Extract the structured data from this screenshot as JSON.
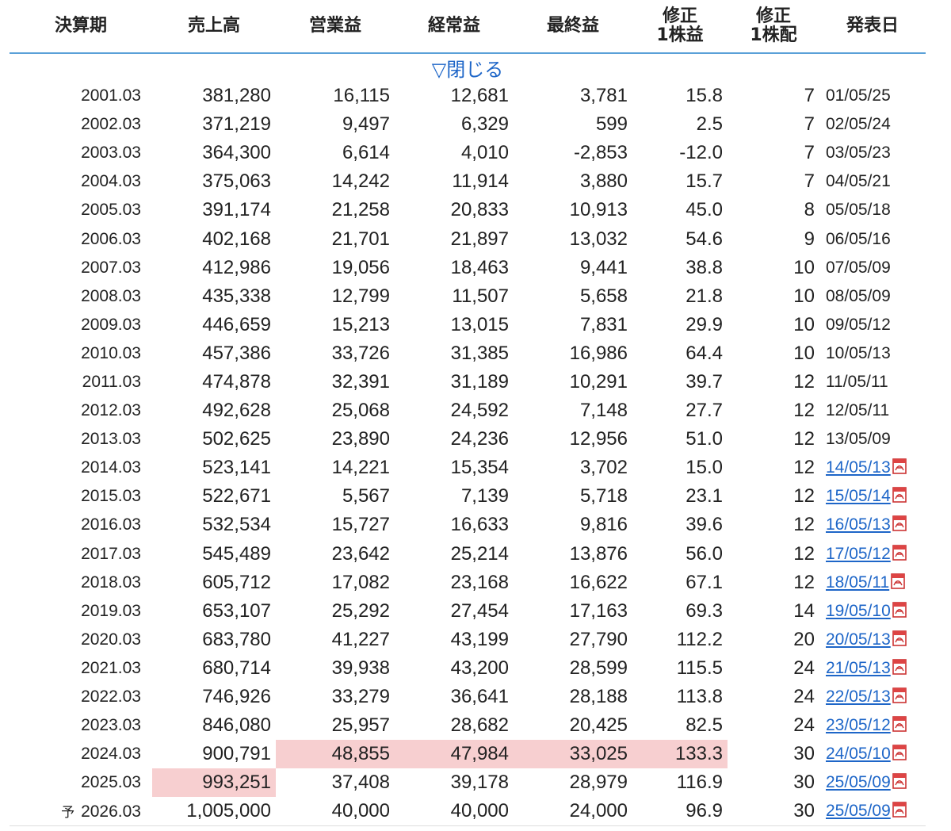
{
  "headers": {
    "period": "決算期",
    "sales": "売上高",
    "operating": "営業益",
    "ordinary": "経常益",
    "net": "最終益",
    "eps_line1": "修正",
    "eps_line2": "1株益",
    "div_line1": "修正",
    "div_line2": "1株配",
    "date": "発表日"
  },
  "toggle_label": "▽閉じる",
  "forecast_mark": "予",
  "colors": {
    "accent": "#1e66c8",
    "highlight": "#f7cfd0",
    "header_line": "#5aa0d8"
  },
  "rows": [
    {
      "period": "2001.03",
      "sales": "381,280",
      "operating": "16,115",
      "ordinary": "12,681",
      "net": "3,781",
      "eps": "15.8",
      "div": "7",
      "date": "01/05/25",
      "link": false
    },
    {
      "period": "2002.03",
      "sales": "371,219",
      "operating": "9,497",
      "ordinary": "6,329",
      "net": "599",
      "eps": "2.5",
      "div": "7",
      "date": "02/05/24",
      "link": false
    },
    {
      "period": "2003.03",
      "sales": "364,300",
      "operating": "6,614",
      "ordinary": "4,010",
      "net": "-2,853",
      "eps": "-12.0",
      "div": "7",
      "date": "03/05/23",
      "link": false
    },
    {
      "period": "2004.03",
      "sales": "375,063",
      "operating": "14,242",
      "ordinary": "11,914",
      "net": "3,880",
      "eps": "15.7",
      "div": "7",
      "date": "04/05/21",
      "link": false
    },
    {
      "period": "2005.03",
      "sales": "391,174",
      "operating": "21,258",
      "ordinary": "20,833",
      "net": "10,913",
      "eps": "45.0",
      "div": "8",
      "date": "05/05/18",
      "link": false
    },
    {
      "period": "2006.03",
      "sales": "402,168",
      "operating": "21,701",
      "ordinary": "21,897",
      "net": "13,032",
      "eps": "54.6",
      "div": "9",
      "date": "06/05/16",
      "link": false
    },
    {
      "period": "2007.03",
      "sales": "412,986",
      "operating": "19,056",
      "ordinary": "18,463",
      "net": "9,441",
      "eps": "38.8",
      "div": "10",
      "date": "07/05/09",
      "link": false
    },
    {
      "period": "2008.03",
      "sales": "435,338",
      "operating": "12,799",
      "ordinary": "11,507",
      "net": "5,658",
      "eps": "21.8",
      "div": "10",
      "date": "08/05/09",
      "link": false
    },
    {
      "period": "2009.03",
      "sales": "446,659",
      "operating": "15,213",
      "ordinary": "13,015",
      "net": "7,831",
      "eps": "29.9",
      "div": "10",
      "date": "09/05/12",
      "link": false
    },
    {
      "period": "2010.03",
      "sales": "457,386",
      "operating": "33,726",
      "ordinary": "31,385",
      "net": "16,986",
      "eps": "64.4",
      "div": "10",
      "date": "10/05/13",
      "link": false
    },
    {
      "period": "2011.03",
      "sales": "474,878",
      "operating": "32,391",
      "ordinary": "31,189",
      "net": "10,291",
      "eps": "39.7",
      "div": "12",
      "date": "11/05/11",
      "link": false
    },
    {
      "period": "2012.03",
      "sales": "492,628",
      "operating": "25,068",
      "ordinary": "24,592",
      "net": "7,148",
      "eps": "27.7",
      "div": "12",
      "date": "12/05/11",
      "link": false
    },
    {
      "period": "2013.03",
      "sales": "502,625",
      "operating": "23,890",
      "ordinary": "24,236",
      "net": "12,956",
      "eps": "51.0",
      "div": "12",
      "date": "13/05/09",
      "link": false
    },
    {
      "period": "2014.03",
      "sales": "523,141",
      "operating": "14,221",
      "ordinary": "15,354",
      "net": "3,702",
      "eps": "15.0",
      "div": "12",
      "date": "14/05/13",
      "link": true
    },
    {
      "period": "2015.03",
      "sales": "522,671",
      "operating": "5,567",
      "ordinary": "7,139",
      "net": "5,718",
      "eps": "23.1",
      "div": "12",
      "date": "15/05/14",
      "link": true
    },
    {
      "period": "2016.03",
      "sales": "532,534",
      "operating": "15,727",
      "ordinary": "16,633",
      "net": "9,816",
      "eps": "39.6",
      "div": "12",
      "date": "16/05/13",
      "link": true
    },
    {
      "period": "2017.03",
      "sales": "545,489",
      "operating": "23,642",
      "ordinary": "25,214",
      "net": "13,876",
      "eps": "56.0",
      "div": "12",
      "date": "17/05/12",
      "link": true
    },
    {
      "period": "2018.03",
      "sales": "605,712",
      "operating": "17,082",
      "ordinary": "23,168",
      "net": "16,622",
      "eps": "67.1",
      "div": "12",
      "date": "18/05/11",
      "link": true
    },
    {
      "period": "2019.03",
      "sales": "653,107",
      "operating": "25,292",
      "ordinary": "27,454",
      "net": "17,163",
      "eps": "69.3",
      "div": "14",
      "date": "19/05/10",
      "link": true
    },
    {
      "period": "2020.03",
      "sales": "683,780",
      "operating": "41,227",
      "ordinary": "43,199",
      "net": "27,790",
      "eps": "112.2",
      "div": "20",
      "date": "20/05/13",
      "link": true
    },
    {
      "period": "2021.03",
      "sales": "680,714",
      "operating": "39,938",
      "ordinary": "43,200",
      "net": "28,599",
      "eps": "115.5",
      "div": "24",
      "date": "21/05/13",
      "link": true
    },
    {
      "period": "2022.03",
      "sales": "746,926",
      "operating": "33,279",
      "ordinary": "36,641",
      "net": "28,188",
      "eps": "113.8",
      "div": "24",
      "date": "22/05/13",
      "link": true
    },
    {
      "period": "2023.03",
      "sales": "846,080",
      "operating": "25,957",
      "ordinary": "28,682",
      "net": "20,425",
      "eps": "82.5",
      "div": "24",
      "date": "23/05/12",
      "link": true
    },
    {
      "period": "2024.03",
      "sales": "900,791",
      "operating": "48,855",
      "ordinary": "47,984",
      "net": "33,025",
      "eps": "133.3",
      "div": "30",
      "date": "24/05/10",
      "link": true,
      "hl": [
        "operating",
        "ordinary",
        "net",
        "eps"
      ]
    },
    {
      "period": "2025.03",
      "sales": "993,251",
      "operating": "37,408",
      "ordinary": "39,178",
      "net": "28,979",
      "eps": "116.9",
      "div": "30",
      "date": "25/05/09",
      "link": true,
      "hl": [
        "sales"
      ]
    },
    {
      "period": "2026.03",
      "sales": "1,005,000",
      "operating": "40,000",
      "ordinary": "40,000",
      "net": "24,000",
      "eps": "96.9",
      "div": "30",
      "date": "25/05/09",
      "link": true,
      "forecast": true
    }
  ]
}
